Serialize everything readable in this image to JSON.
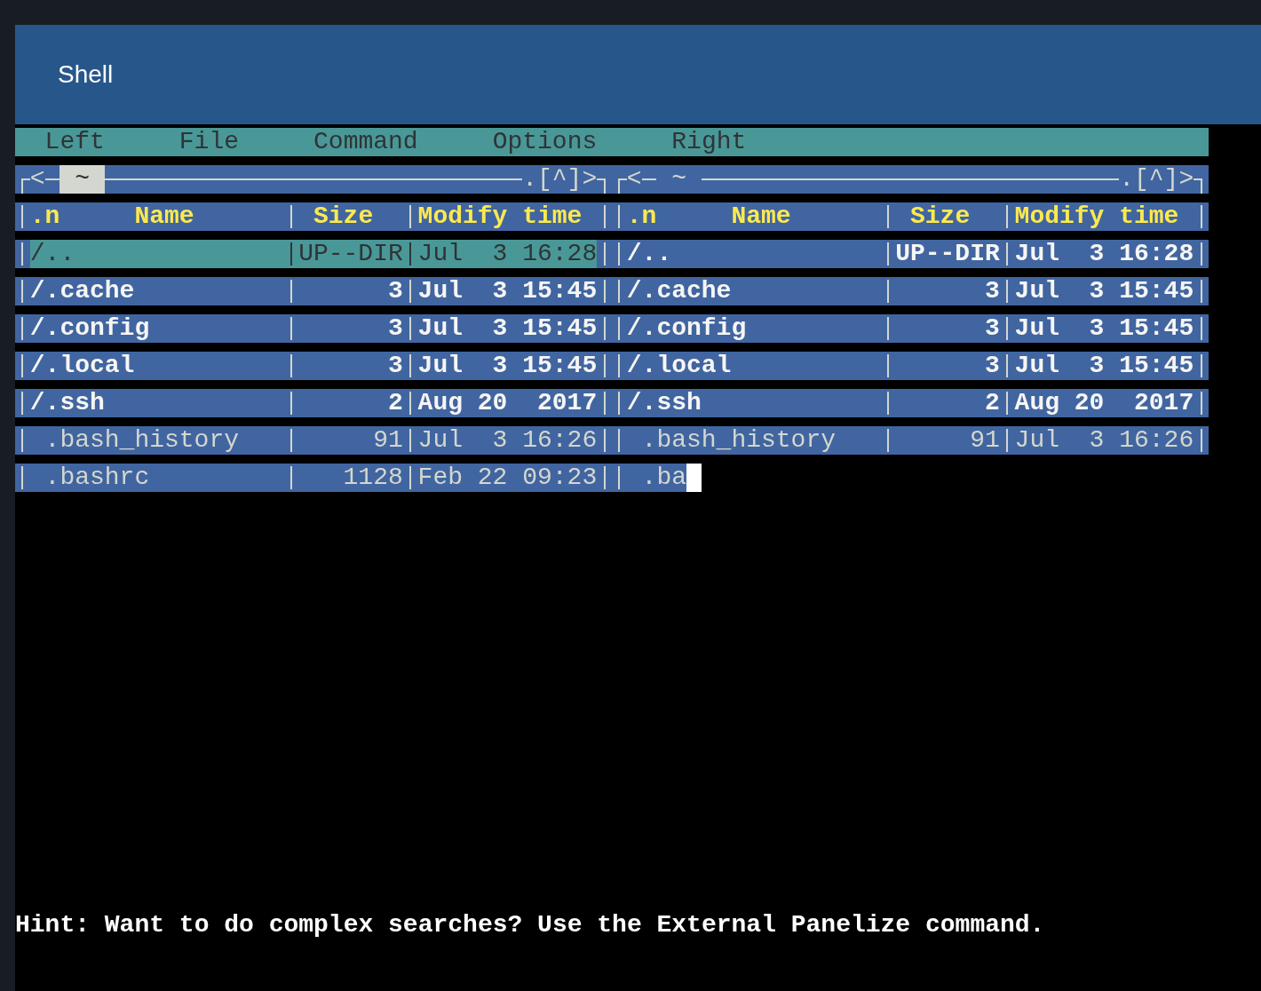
{
  "window": {
    "title": "Shell"
  },
  "menu": [
    "Left",
    "File",
    "Command",
    "Options",
    "Right"
  ],
  "panels": [
    {
      "active": true,
      "history_back": "<",
      "path": "~",
      "controls": ".[^]>",
      "sort_indicator": ".n",
      "columns": [
        "Name",
        "Size",
        "Modify time"
      ],
      "rows": [
        {
          "kind": "dir",
          "name": "/..",
          "size": "UP--DIR",
          "time": "Jul  3 16:28",
          "selected": true
        },
        {
          "kind": "dir",
          "name": "/.cache",
          "size": "3",
          "time": "Jul  3 15:45",
          "selected": false
        },
        {
          "kind": "dir",
          "name": "/.config",
          "size": "3",
          "time": "Jul  3 15:45",
          "selected": false
        },
        {
          "kind": "dir",
          "name": "/.local",
          "size": "3",
          "time": "Jul  3 15:45",
          "selected": false
        },
        {
          "kind": "dir",
          "name": "/.ssh",
          "size": "2",
          "time": "Aug 20  2017",
          "selected": false
        },
        {
          "kind": "file",
          "name": ".bash_history",
          "size": "91",
          "time": "Jul  3 16:26",
          "selected": false
        },
        {
          "kind": "file",
          "name": ".bashrc",
          "size": "1128",
          "time": "Feb 22 09:23",
          "selected": false
        }
      ]
    },
    {
      "active": false,
      "history_back": "<",
      "path": "~",
      "controls": ".[^]>",
      "sort_indicator": ".n",
      "columns": [
        "Name",
        "Size",
        "Modify time"
      ],
      "rows": [
        {
          "kind": "dir",
          "name": "/..",
          "size": "UP--DIR",
          "time": "Jul  3 16:28",
          "selected": false
        },
        {
          "kind": "dir",
          "name": "/.cache",
          "size": "3",
          "time": "Jul  3 15:45",
          "selected": false
        },
        {
          "kind": "dir",
          "name": "/.config",
          "size": "3",
          "time": "Jul  3 15:45",
          "selected": false
        },
        {
          "kind": "dir",
          "name": "/.local",
          "size": "3",
          "time": "Jul  3 15:45",
          "selected": false
        },
        {
          "kind": "dir",
          "name": "/.ssh",
          "size": "2",
          "time": "Aug 20  2017",
          "selected": false
        },
        {
          "kind": "file",
          "name": ".bash_history",
          "size": "91",
          "time": "Jul  3 16:26",
          "selected": false
        },
        {
          "kind": "file",
          "name": ".ba",
          "selected": false
        }
      ]
    }
  ],
  "cursor_visible": true,
  "hint": "Hint: Want to do complex searches? Use the External Panelize command."
}
